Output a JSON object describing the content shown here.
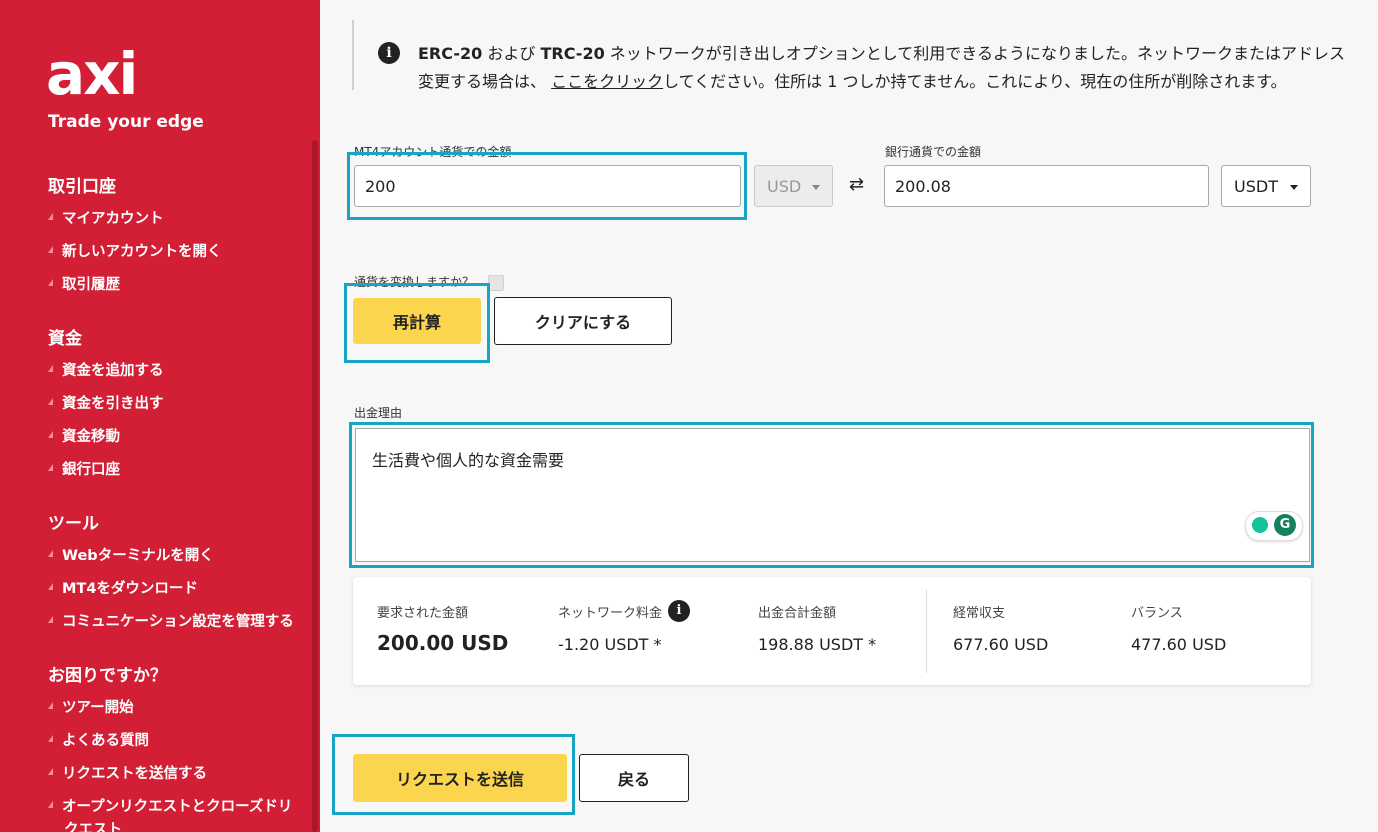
{
  "brand": {
    "logo": "axi",
    "tagline": "Trade your edge"
  },
  "sidebar": {
    "sections": [
      {
        "title": "取引口座",
        "items": [
          "マイアカウント",
          "新しいアカウントを開く",
          "取引履歴"
        ]
      },
      {
        "title": "資金",
        "items": [
          "資金を追加する",
          "資金を引き出す",
          "資金移動",
          "銀行口座"
        ]
      },
      {
        "title": "ツール",
        "items": [
          "Webターミナルを開く",
          "MT4をダウンロード",
          "コミュニケーション設定を管理する"
        ]
      },
      {
        "title": "お困りですか？",
        "items": [
          "ツアー開始",
          "よくある質問",
          "リクエストを送信する",
          "オープンリクエストとクローズドリ",
          "クエスト"
        ]
      }
    ]
  },
  "notice": {
    "erc": "ERC-20",
    "and": " および ",
    "trc": "TRC-20",
    "line1_rest": " ネットワークが引き出しオプションとして利用できるようになりました。ネットワークまたはアドレス",
    "line2_pre": "変更する場合は、 ",
    "link": "ここをクリック",
    "line2_post": "してください。住所は 1 つしか持てません。これにより、現在の住所が削除されます。"
  },
  "form": {
    "mt4_label": "MT4アカウント通貨での金額",
    "mt4_value": "200",
    "mt4_currency": "USD",
    "bank_label": "銀行通貨での金額",
    "bank_value": "200.08",
    "bank_currency": "USDT",
    "swap_icon": "⇄",
    "convert_label": "通貨を変換しますか？",
    "recalc_button": "再計算",
    "clear_button": "クリアにする",
    "reason_label": "出金理由",
    "reason_value": "生活費や個人的な資金需要",
    "grammarly_icon_letter": "G"
  },
  "summary": {
    "requested_label": "要求された金額",
    "requested_value": "200.00 USD",
    "fee_label": "ネットワーク料金",
    "fee_info": "i",
    "fee_value": "-1.20 USDT *",
    "total_label": "出金合計金額",
    "total_value": "198.88 USDT *",
    "income_label": "経常収支",
    "income_value": "677.60 USD",
    "balance_label": "バランス",
    "balance_value": "477.60 USD"
  },
  "actions": {
    "submit": "リクエストを送信",
    "back": "戻る"
  },
  "colors": {
    "sidebar": "#d21f36",
    "accent_yellow": "#fcd54e",
    "highlight": "#17a4c5"
  }
}
